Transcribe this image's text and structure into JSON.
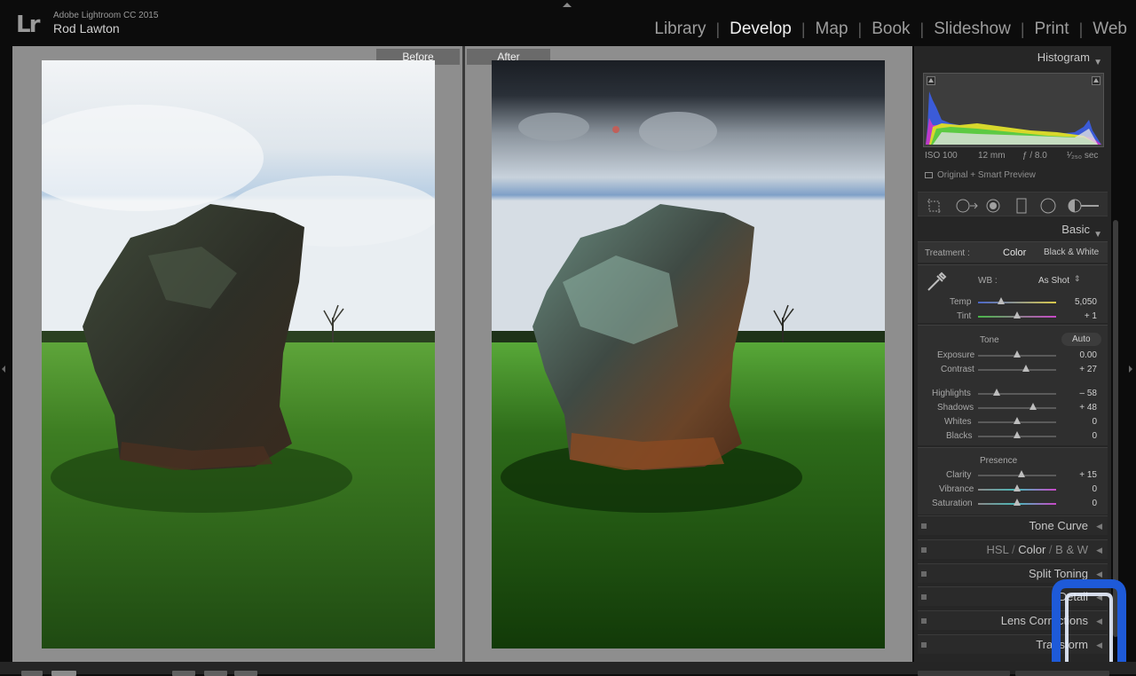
{
  "app": {
    "name": "Adobe Lightroom CC 2015",
    "user": "Rod Lawton",
    "logo_text": "Lr"
  },
  "modules": [
    {
      "label": "Library",
      "active": false
    },
    {
      "label": "Develop",
      "active": true
    },
    {
      "label": "Map",
      "active": false
    },
    {
      "label": "Book",
      "active": false
    },
    {
      "label": "Slideshow",
      "active": false
    },
    {
      "label": "Print",
      "active": false
    },
    {
      "label": "Web",
      "active": false
    }
  ],
  "compare": {
    "before_label": "Before",
    "after_label": "After"
  },
  "histogram": {
    "title": "Histogram",
    "exif": {
      "iso": "ISO 100",
      "focal": "12 mm",
      "aperture": "ƒ / 8.0",
      "shutter": "¹⁄₂₅₀ sec"
    },
    "preview": "Original + Smart Preview"
  },
  "tools": [
    "crop-overlay-icon",
    "spot-removal-icon",
    "red-eye-icon",
    "graduated-filter-icon",
    "radial-filter-icon",
    "adjustment-brush-icon"
  ],
  "basic": {
    "title": "Basic",
    "treatment_label": "Treatment :",
    "treatment_color": "Color",
    "treatment_bw": "Black & White",
    "wb_label": "WB :",
    "wb_value": "As Shot",
    "temp": {
      "label": "Temp",
      "value": "5,050",
      "pos": 0.3
    },
    "tint": {
      "label": "Tint",
      "value": "+ 1",
      "pos": 0.5
    },
    "tone_label": "Tone",
    "auto_label": "Auto",
    "exposure": {
      "label": "Exposure",
      "value": "0.00",
      "pos": 0.5
    },
    "contrast": {
      "label": "Contrast",
      "value": "+ 27",
      "pos": 0.61
    },
    "highlights": {
      "label": "Highlights",
      "value": "– 58",
      "pos": 0.24
    },
    "shadows": {
      "label": "Shadows",
      "value": "+ 48",
      "pos": 0.7
    },
    "whites": {
      "label": "Whites",
      "value": "0",
      "pos": 0.5
    },
    "blacks": {
      "label": "Blacks",
      "value": "0",
      "pos": 0.5
    },
    "presence_label": "Presence",
    "clarity": {
      "label": "Clarity",
      "value": "+ 15",
      "pos": 0.56
    },
    "vibrance": {
      "label": "Vibrance",
      "value": "0",
      "pos": 0.5
    },
    "saturation": {
      "label": "Saturation",
      "value": "0",
      "pos": 0.5
    }
  },
  "collapsed_panels": {
    "tone_curve": "Tone Curve",
    "hsl": "HSL",
    "color": "Color",
    "bw": "B & W",
    "split_toning": "Split Toning",
    "detail": "Detail",
    "lens": "Lens Corrections",
    "transform": "Transform"
  },
  "colors": {
    "active_module": "#f2f2f2",
    "panel_bg": "#262626",
    "canvas_bg": "#8e8e8e"
  }
}
